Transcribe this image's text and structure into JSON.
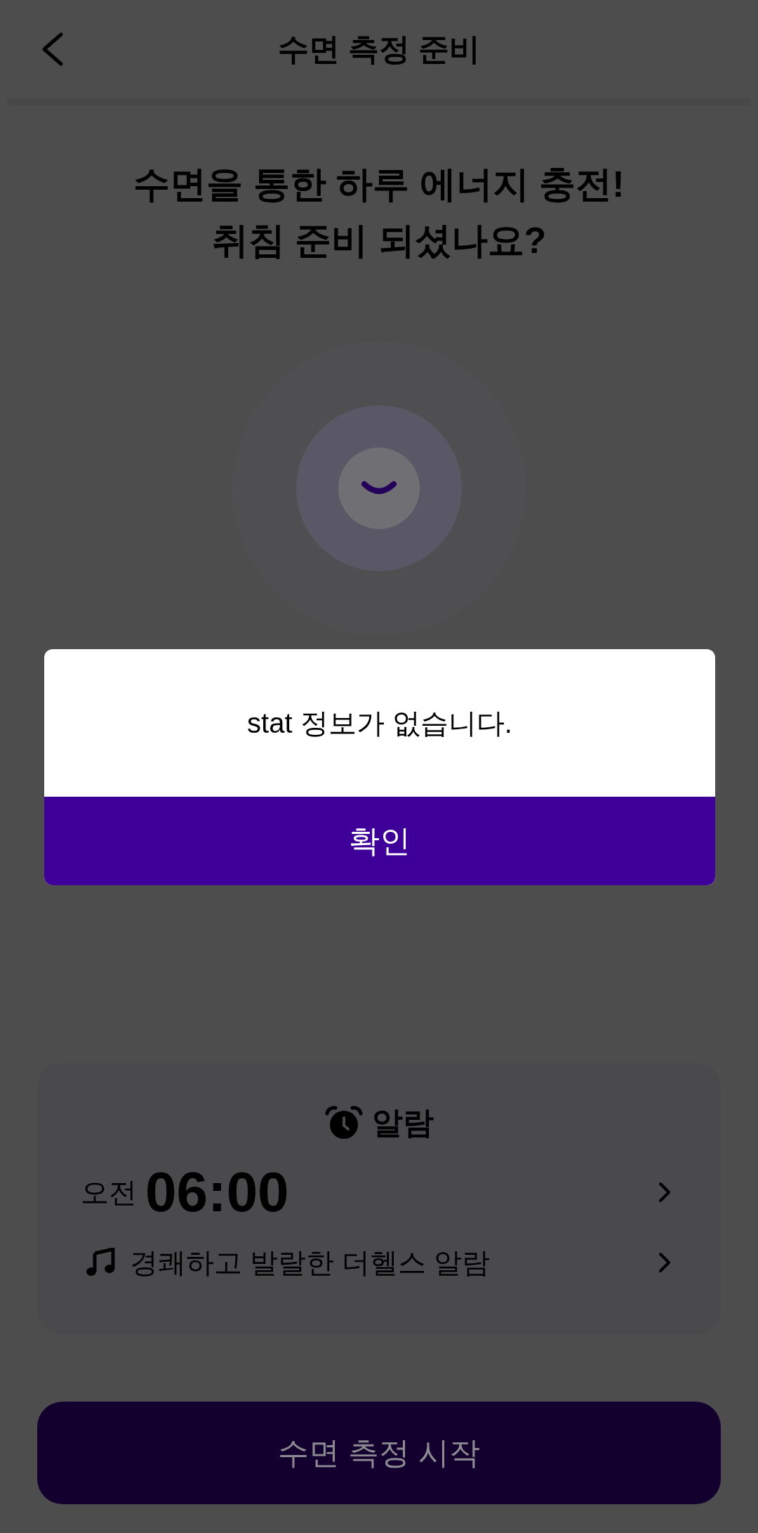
{
  "header": {
    "title": "수면 측정 준비"
  },
  "headline": [
    "수면을 통한 하루 에너지 충전!",
    "취침 준비 되셨나요?"
  ],
  "alarm_card": {
    "title": "알람",
    "period": "오전",
    "time": "06:00",
    "sound": "경쾌하고 발랄한 더헬스 알람"
  },
  "start_button": {
    "label": "수면 측정 시작",
    "disabled": true
  },
  "dialog": {
    "message": "stat 정보가 없습니다.",
    "confirm": "확인"
  }
}
